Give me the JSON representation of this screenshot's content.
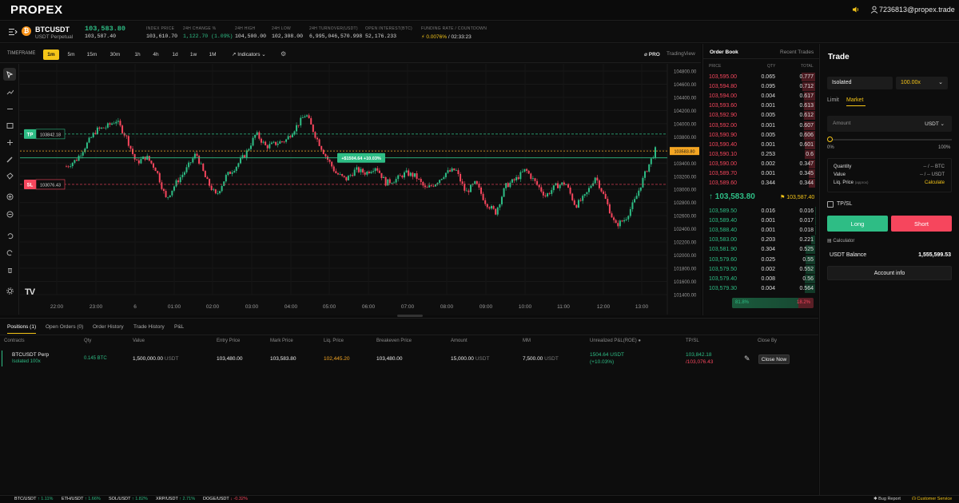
{
  "topbar": {
    "logo": "PROPEX",
    "email": "7236813@propex.trade"
  },
  "ticker": {
    "symbol": "BTCUSDT",
    "subtitle": "USDT Perpetual",
    "last_price": "103,583.80",
    "mark_price": "103,587.40",
    "stats": [
      {
        "label": "INDEX PRICE",
        "value": "103,610.70",
        "color": "#dcdcdc"
      },
      {
        "label": "24H CHANGE %",
        "value": "1,122.70 (1.09%)",
        "color": "#2ebd85"
      },
      {
        "label": "24H HIGH",
        "value": "104,500.00",
        "color": "#dcdcdc"
      },
      {
        "label": "24H LOW",
        "value": "102,308.00",
        "color": "#dcdcdc"
      },
      {
        "label": "24H TURNOVER(USDT)",
        "value": "6,995,046,570.998",
        "color": "#dcdcdc"
      },
      {
        "label": "OPEN INTEREST(BTC)",
        "value": "52,176.233",
        "color": "#dcdcdc"
      }
    ],
    "funding_label": "FUNDING RATE / COUNTDOWN",
    "funding_rate": "0.0076%",
    "countdown": " / 02:33:23"
  },
  "timeframe": {
    "label": "TIMEFRAME",
    "options": [
      "1m",
      "5m",
      "15m",
      "30m",
      "1h",
      "4h",
      "1d",
      "1w",
      "1M"
    ],
    "selected": "1m",
    "indicators": "Indicators",
    "pro": "PRO",
    "tradingview": "TradingView"
  },
  "chart_data": {
    "type": "candlestick",
    "symbol": "BTCUSDT",
    "interval": "1m",
    "y_ticks": [
      "104800.00",
      "104600.00",
      "104400.00",
      "104200.00",
      "104000.00",
      "103800.00",
      "103600.00",
      "103400.00",
      "103200.00",
      "103000.00",
      "102800.00",
      "102600.00",
      "102400.00",
      "102200.00",
      "102000.00",
      "101800.00",
      "101600.00",
      "101400.00"
    ],
    "ylim": [
      101400,
      104800
    ],
    "x_ticks": [
      "22:00",
      "23:00",
      "6",
      "01:00",
      "02:00",
      "03:00",
      "04:00",
      "05:00",
      "06:00",
      "07:00",
      "08:00",
      "09:00",
      "10:00",
      "11:00",
      "12:00",
      "13:00"
    ],
    "close_path": [
      103350,
      103450,
      103680,
      103900,
      103950,
      104050,
      103800,
      103400,
      103500,
      103300,
      102850,
      103100,
      103300,
      103550,
      103150,
      102900,
      103200,
      103350,
      103550,
      103850,
      103650,
      103700,
      103750,
      103950,
      104150,
      103800,
      103500,
      103250,
      103150,
      103300,
      103250,
      103350,
      103100,
      103150,
      103250,
      103200,
      103000,
      103100,
      103250,
      103300,
      102950,
      103100,
      102800,
      102650,
      103050,
      103150,
      103300,
      103100,
      102900,
      103050,
      103100,
      102750,
      102900,
      103200,
      102850,
      102450,
      102550,
      102850,
      103250,
      103600
    ],
    "tp": {
      "label": "TP",
      "value": "103842.18"
    },
    "sl": {
      "label": "SL",
      "value": "103076.43"
    },
    "position_tag": "+$1504.64 +10.03%",
    "last_price_tag": "103583.80",
    "tv_logo": "TV"
  },
  "orderbook": {
    "tabs": [
      "Order Book",
      "Recent Trades"
    ],
    "headers": [
      "PRICE",
      "QTY",
      "TOTAL"
    ],
    "asks": [
      [
        "103,595.00",
        "0.065",
        "0.777"
      ],
      [
        "103,594.80",
        "0.095",
        "0.712"
      ],
      [
        "103,594.00",
        "0.004",
        "0.617"
      ],
      [
        "103,593.60",
        "0.001",
        "0.613"
      ],
      [
        "103,592.90",
        "0.005",
        "0.612"
      ],
      [
        "103,592.00",
        "0.001",
        "0.607"
      ],
      [
        "103,590.90",
        "0.005",
        "0.606"
      ],
      [
        "103,590.40",
        "0.001",
        "0.601"
      ],
      [
        "103,590.10",
        "0.253",
        "0.6"
      ],
      [
        "103,590.00",
        "0.002",
        "0.347"
      ],
      [
        "103,589.70",
        "0.001",
        "0.345"
      ],
      [
        "103,589.60",
        "0.344",
        "0.344"
      ]
    ],
    "mid_price": "103,583.80",
    "mid_mark": "103,587.40",
    "bids": [
      [
        "103,589.50",
        "0.016",
        "0.016"
      ],
      [
        "103,589.40",
        "0.001",
        "0.017"
      ],
      [
        "103,588.40",
        "0.001",
        "0.018"
      ],
      [
        "103,583.00",
        "0.203",
        "0.221"
      ],
      [
        "103,581.90",
        "0.304",
        "0.525"
      ],
      [
        "103,579.60",
        "0.025",
        "0.55"
      ],
      [
        "103,579.50",
        "0.002",
        "0.552"
      ],
      [
        "103,579.40",
        "0.008",
        "0.56"
      ],
      [
        "103,579.30",
        "0.004",
        "0.564"
      ]
    ],
    "ratio_buy": "81.8%",
    "ratio_sell": "18.2%",
    "buy_fraction": 0.818
  },
  "trade": {
    "title": "Trade",
    "margin_mode": "Isolated",
    "leverage": "100.00x",
    "tabs": [
      "Limit",
      "Market"
    ],
    "selected_tab": "Market",
    "amount_placeholder": "Amount",
    "amount_unit": "USDT",
    "slider_min": "0%",
    "slider_max": "100%",
    "info": [
      {
        "label": "Quantity",
        "value": "-- / -- BTC"
      },
      {
        "label": "Value",
        "value": "-- / -- USDT"
      },
      {
        "label": "Liq. Price",
        "value": "Calculate"
      }
    ],
    "liq_note": "(approx)",
    "tpsl": "TP/SL",
    "long": "Long",
    "short": "Short",
    "calculator": "Calculator",
    "balance_label": "USDT Balance",
    "balance": "1,555,599.53",
    "account_info": "Account info"
  },
  "positions": {
    "tabs": [
      "Positions (1)",
      "Open Orders (0)",
      "Order History",
      "Trade History",
      "P&L"
    ],
    "headers": [
      "Contracts",
      "Qty",
      "Value",
      "Entry Price",
      "Mark Price",
      "Liq. Price",
      "Breakeven Price",
      "Amount",
      "MM",
      "Unrealized P&L(ROE) ●",
      "TP/SL",
      "Close By"
    ],
    "row": {
      "contract": "BTCUSDT Perp",
      "mode": "Isolated 100x",
      "qty": "0.145 BTC",
      "value": "1,500,000.00",
      "value_unit": "USDT",
      "entry": "103,480.00",
      "mark": "103,583.80",
      "liq": "102,445.20",
      "breakeven": "103,480.00",
      "amount": "15,000.00",
      "amount_unit": "USDT",
      "mm": "7,500.00",
      "mm_unit": "USDT",
      "pnl": "1504.64 USDT",
      "roe": "(+10.03%)",
      "tp": "103,842.18",
      "sl": "/103,076.43",
      "close": "Close Now"
    }
  },
  "status": {
    "tickers": [
      {
        "sym": "BTC/USDT",
        "chg": "↑ 1.11%",
        "color": "#2ebd85"
      },
      {
        "sym": "ETH/USDT",
        "chg": "↑ 1.66%",
        "color": "#2ebd85"
      },
      {
        "sym": "SOL/USDT",
        "chg": "↑ 1.82%",
        "color": "#2ebd85"
      },
      {
        "sym": "XRP/USDT",
        "chg": "↑ 2.71%",
        "color": "#2ebd85"
      },
      {
        "sym": "DOGE/USDT",
        "chg": "↓ -0.32%",
        "color": "#f6465d"
      }
    ],
    "bug": "Bug Report",
    "support": "Customer Service"
  }
}
